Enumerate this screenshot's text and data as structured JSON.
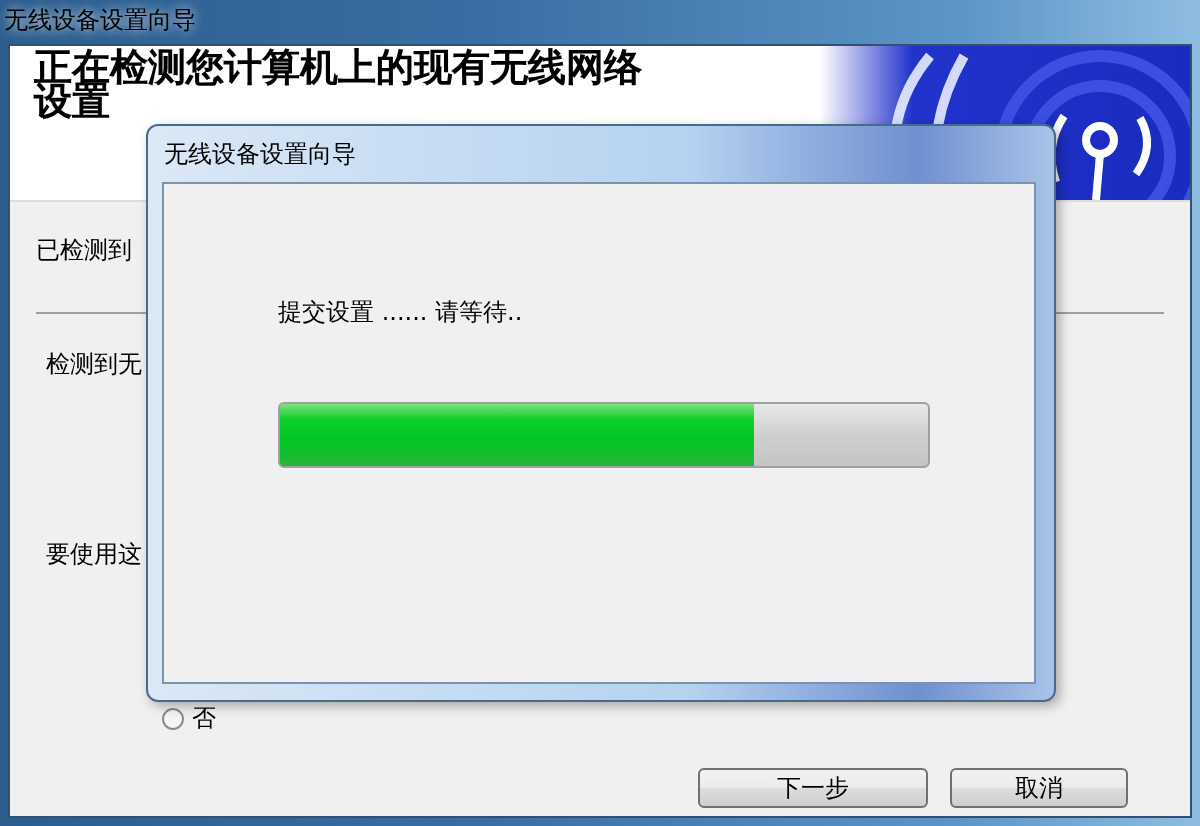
{
  "window": {
    "title": "无线设备设置向导"
  },
  "header": {
    "title": "正在检测您计算机上的现有无线网络设置"
  },
  "body": {
    "lines": [
      "已检测到",
      "检测到无",
      "要使用这"
    ],
    "radio": {
      "label": "否",
      "selected": false
    }
  },
  "buttons": [
    {
      "label": "下一步"
    },
    {
      "label": "取消"
    }
  ],
  "dialog": {
    "title": "无线设备设置向导",
    "message": "提交设置 ...... 请等待..",
    "progress": {
      "level": 0.73
    }
  }
}
